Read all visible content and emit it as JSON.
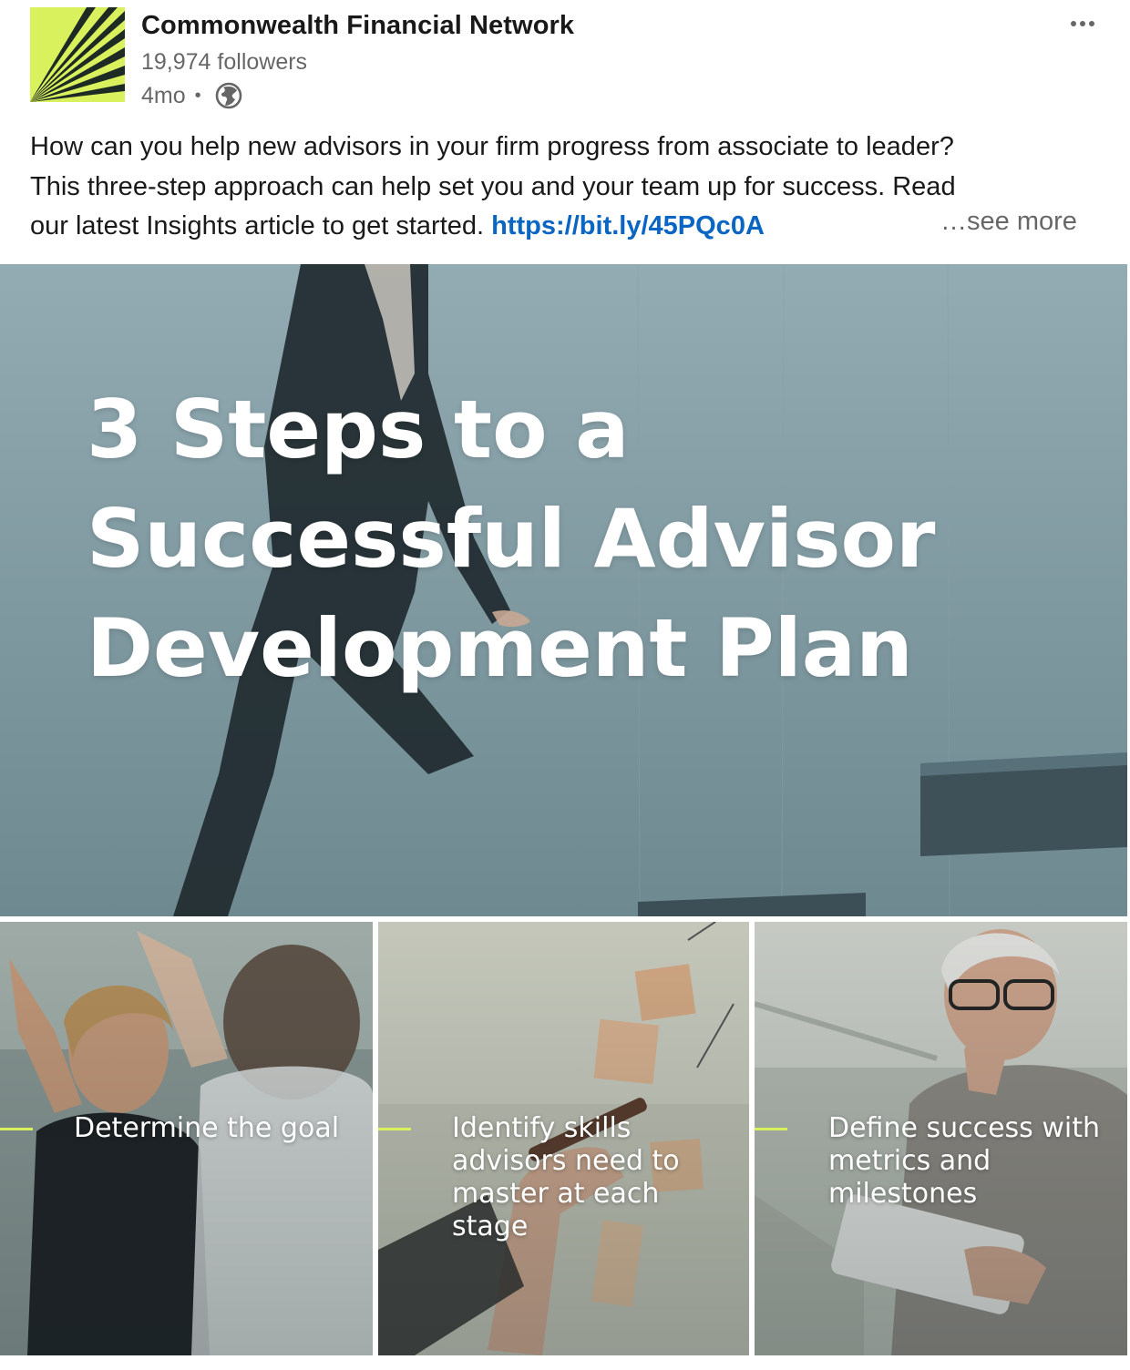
{
  "post": {
    "author": {
      "name": "Commonwealth Financial Network",
      "followers": "19,974 followers",
      "time": "4mo",
      "separator": "•",
      "logo_icon": "commonwealth-logo-icon",
      "visibility_icon": "globe-icon"
    },
    "menu_icon": "more-options-icon",
    "commentary": {
      "line1": "How can you help new advisors in your firm progress from associate to leader?",
      "line2": "This three-step approach can help set you and your team up for success. Read",
      "line3": "our latest Insights article to get started.",
      "link": "https://bit.ly/45PQc0A",
      "see_more": "…see more"
    },
    "hero": {
      "title_line1": "3 Steps to a",
      "title_line2": "Successful Advisor",
      "title_line3": "Development Plan"
    },
    "steps": [
      {
        "text": "Determine the goal"
      },
      {
        "text": "Identify skills advisors need to master at each stage"
      },
      {
        "text": "Define success with metrics and milestones"
      }
    ]
  },
  "colors": {
    "brand_lime": "#d9f15d",
    "link_blue": "#0a66c2",
    "hero_tint": "#7f989f"
  }
}
